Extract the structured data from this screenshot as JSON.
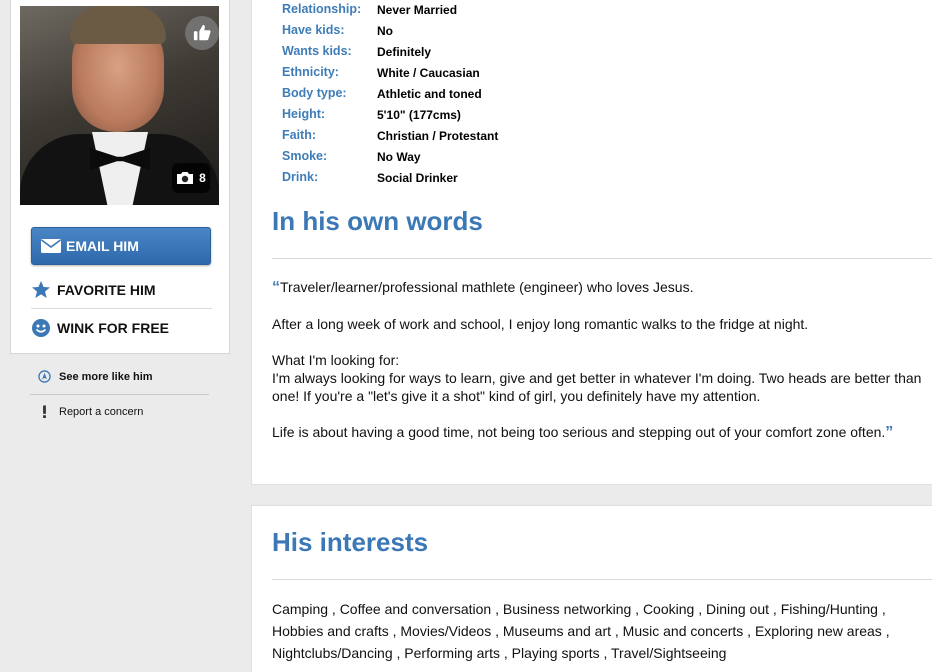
{
  "sidebar": {
    "photo_count": "8",
    "email_label": "EMAIL HIM",
    "favorite_label": "FAVORITE HIM",
    "wink_label": "WINK FOR FREE",
    "see_more_label": "See more like him",
    "report_label": "Report a concern"
  },
  "details": [
    {
      "label": "Relationship:",
      "value": "Never Married"
    },
    {
      "label": "Have kids:",
      "value": "No"
    },
    {
      "label": "Wants kids:",
      "value": "Definitely"
    },
    {
      "label": "Ethnicity:",
      "value": "White / Caucasian"
    },
    {
      "label": "Body type:",
      "value": "Athletic and toned"
    },
    {
      "label": "Height:",
      "value": "5'10\" (177cms)"
    },
    {
      "label": "Faith:",
      "value": "Christian / Protestant"
    },
    {
      "label": "Smoke:",
      "value": "No Way"
    },
    {
      "label": "Drink:",
      "value": "Social Drinker"
    }
  ],
  "own_words": {
    "title": "In his own words",
    "open_quote": "“",
    "close_quote": "”",
    "p1": "Traveler/learner/professional mathlete (engineer) who loves Jesus.",
    "p2": "After a long week of work and school, I enjoy long romantic walks to the fridge at night.",
    "p3_heading": "What I'm looking for:",
    "p3_body": "I'm always looking for ways to learn, give and get better in whatever I'm doing.  Two heads are better than one!  If you're a \"let's give it a shot\" kind of girl, you definitely have my attention.",
    "p4": "Life is about having a good time, not being too serious and stepping out of your comfort zone often."
  },
  "interests": {
    "title": "His interests",
    "text": "Camping , Coffee and conversation , Business networking , Cooking , Dining out , Fishing/Hunting , Hobbies and crafts , Movies/Videos , Museums and art , Music and concerts , Exploring new areas , Nightclubs/Dancing , Performing arts , Playing sports , Travel/Sightseeing"
  },
  "colors": {
    "accent": "#3b78b5",
    "button": "#2e6aab",
    "background": "#ebebeb"
  },
  "icons": [
    "thumbs-up-icon",
    "camera-icon",
    "envelope-icon",
    "star-icon",
    "smiley-icon",
    "compass-icon",
    "exclamation-icon"
  ]
}
